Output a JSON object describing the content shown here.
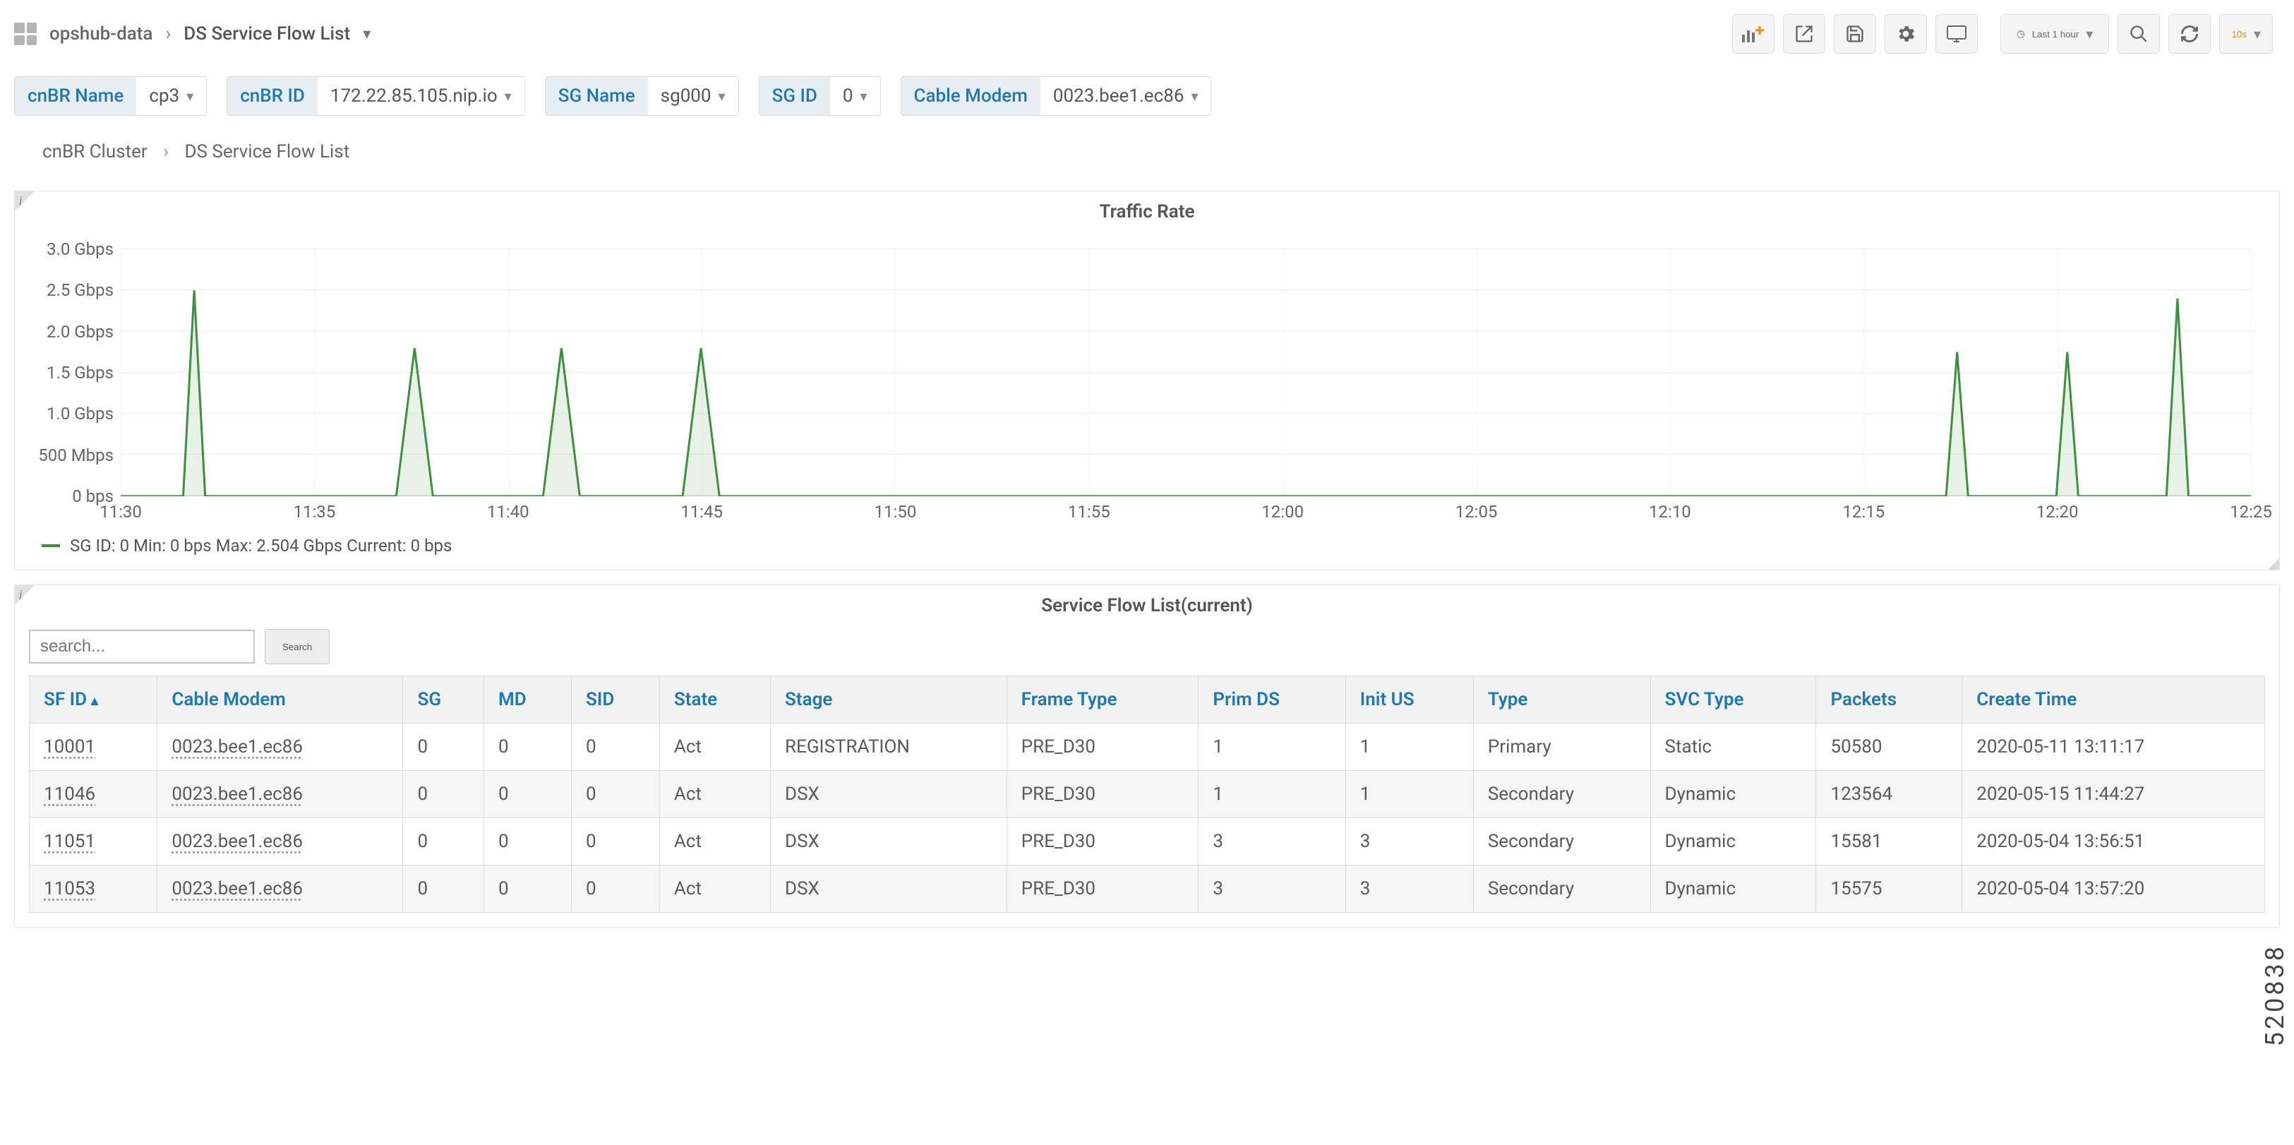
{
  "header": {
    "parent": "opshub-data",
    "title": "DS Service Flow List",
    "time_label": "Last 1 hour",
    "refresh_interval": "10s"
  },
  "vars": {
    "items": [
      {
        "label": "cnBR Name",
        "value": "cp3"
      },
      {
        "label": "cnBR ID",
        "value": "172.22.85.105.nip.io"
      },
      {
        "label": "SG Name",
        "value": "sg000"
      },
      {
        "label": "SG ID",
        "value": "0"
      },
      {
        "label": "Cable Modem",
        "value": "0023.bee1.ec86"
      }
    ]
  },
  "drill": {
    "level1": "cnBR Cluster",
    "level2": "DS Service Flow List"
  },
  "chart_data": {
    "type": "line",
    "title": "Traffic Rate",
    "ylabel": "",
    "ylim": [
      0,
      3.0
    ],
    "y_unit_suffix": " Gbps",
    "y_zero_label": "0 bps",
    "y_ticks": [
      "0 bps",
      "500 Mbps",
      "1.0 Gbps",
      "1.5 Gbps",
      "2.0 Gbps",
      "2.5 Gbps",
      "3.0 Gbps"
    ],
    "x_ticks": [
      "11:30",
      "11:35",
      "11:40",
      "11:45",
      "11:50",
      "11:55",
      "12:00",
      "12:05",
      "12:10",
      "12:15",
      "12:20",
      "12:25"
    ],
    "series": [
      {
        "name": "SG ID: 0",
        "color": "#3e8f3e",
        "x_minutes_from_start": [
          0,
          1.7,
          2.0,
          2.3,
          7.5,
          8.0,
          8.5,
          11.5,
          12.0,
          12.5,
          15.3,
          15.8,
          16.3,
          49.7,
          50.0,
          50.3,
          52.7,
          53.0,
          53.3,
          55.7,
          56.0,
          56.3,
          58.0
        ],
        "y_gbps": [
          0,
          0,
          2.5,
          0,
          0,
          1.8,
          0,
          0,
          1.8,
          0,
          0,
          1.8,
          0,
          0,
          1.75,
          0,
          0,
          1.75,
          0,
          0,
          2.4,
          0,
          0
        ]
      }
    ],
    "legend_stats": {
      "name": "SG ID: 0",
      "min": "0 bps",
      "max": "2.504 Gbps",
      "current": "0 bps"
    }
  },
  "table": {
    "title": "Service Flow List(current)",
    "search_placeholder": "search...",
    "search_button": "Search",
    "columns": [
      "SF ID",
      "Cable Modem",
      "SG",
      "MD",
      "SID",
      "State",
      "Stage",
      "Frame Type",
      "Prim DS",
      "Init US",
      "Type",
      "SVC Type",
      "Packets",
      "Create Time"
    ],
    "sort_col": "SF ID",
    "rows": [
      {
        "SF ID": "10001",
        "Cable Modem": "0023.bee1.ec86",
        "SG": "0",
        "MD": "0",
        "SID": "0",
        "State": "Act",
        "Stage": "REGISTRATION",
        "Frame Type": "PRE_D30",
        "Prim DS": "1",
        "Init US": "1",
        "Type": "Primary",
        "SVC Type": "Static",
        "Packets": "50580",
        "Create Time": "2020-05-11 13:11:17"
      },
      {
        "SF ID": "11046",
        "Cable Modem": "0023.bee1.ec86",
        "SG": "0",
        "MD": "0",
        "SID": "0",
        "State": "Act",
        "Stage": "DSX",
        "Frame Type": "PRE_D30",
        "Prim DS": "1",
        "Init US": "1",
        "Type": "Secondary",
        "SVC Type": "Dynamic",
        "Packets": "123564",
        "Create Time": "2020-05-15 11:44:27"
      },
      {
        "SF ID": "11051",
        "Cable Modem": "0023.bee1.ec86",
        "SG": "0",
        "MD": "0",
        "SID": "0",
        "State": "Act",
        "Stage": "DSX",
        "Frame Type": "PRE_D30",
        "Prim DS": "3",
        "Init US": "3",
        "Type": "Secondary",
        "SVC Type": "Dynamic",
        "Packets": "15581",
        "Create Time": "2020-05-04 13:56:51"
      },
      {
        "SF ID": "11053",
        "Cable Modem": "0023.bee1.ec86",
        "SG": "0",
        "MD": "0",
        "SID": "0",
        "State": "Act",
        "Stage": "DSX",
        "Frame Type": "PRE_D30",
        "Prim DS": "3",
        "Init US": "3",
        "Type": "Secondary",
        "SVC Type": "Dynamic",
        "Packets": "15575",
        "Create Time": "2020-05-04 13:57:20"
      }
    ]
  },
  "side_stamp": "520838",
  "icons": {
    "clock": "◷",
    "share": "↗",
    "save": "🖫",
    "gear": "⚙",
    "monitor": "🖵",
    "zoom": "🔍",
    "refresh": "⟳",
    "panel_add": "add"
  }
}
